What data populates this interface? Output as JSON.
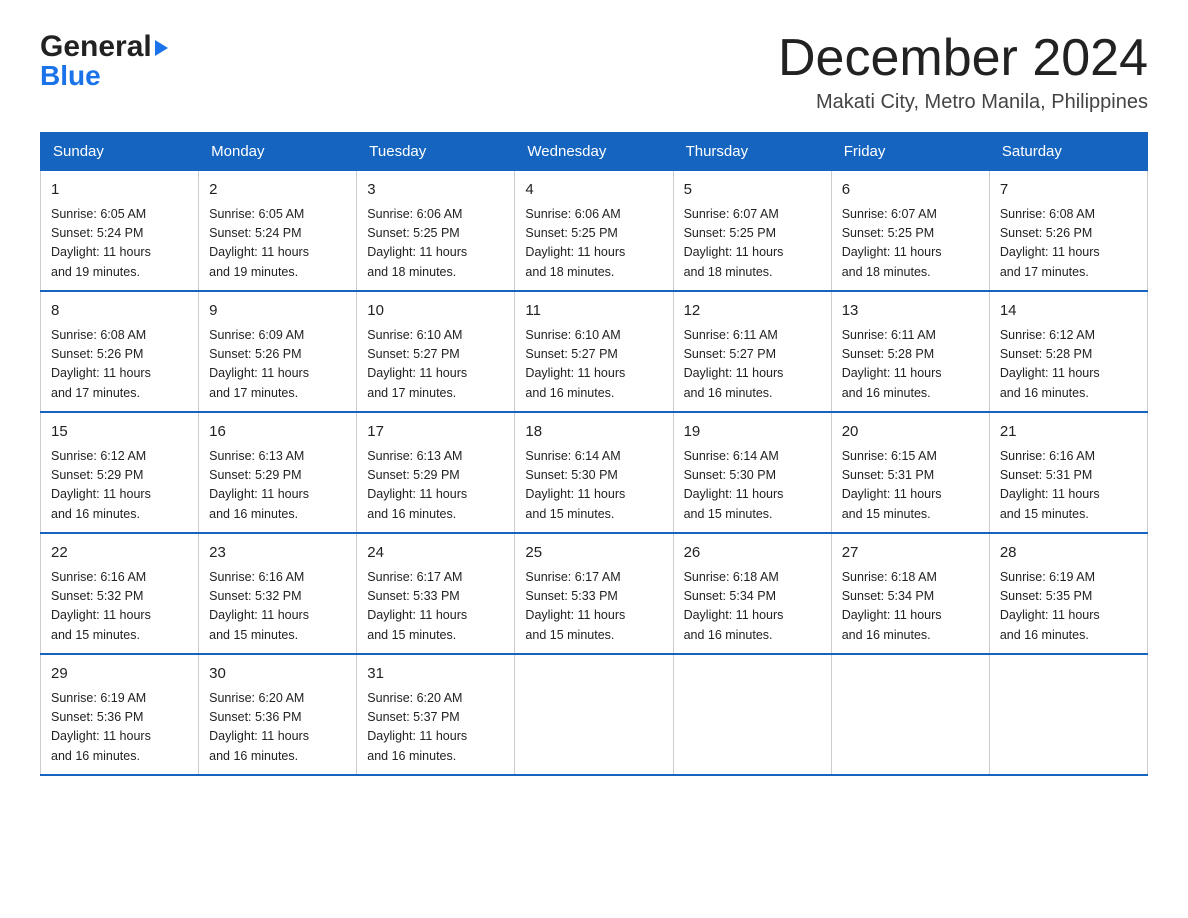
{
  "header": {
    "logo_general": "General",
    "logo_blue": "Blue",
    "month_title": "December 2024",
    "location": "Makati City, Metro Manila, Philippines"
  },
  "weekdays": [
    "Sunday",
    "Monday",
    "Tuesday",
    "Wednesday",
    "Thursday",
    "Friday",
    "Saturday"
  ],
  "weeks": [
    [
      {
        "day": "1",
        "sunrise": "6:05 AM",
        "sunset": "5:24 PM",
        "daylight": "11 hours and 19 minutes."
      },
      {
        "day": "2",
        "sunrise": "6:05 AM",
        "sunset": "5:24 PM",
        "daylight": "11 hours and 19 minutes."
      },
      {
        "day": "3",
        "sunrise": "6:06 AM",
        "sunset": "5:25 PM",
        "daylight": "11 hours and 18 minutes."
      },
      {
        "day": "4",
        "sunrise": "6:06 AM",
        "sunset": "5:25 PM",
        "daylight": "11 hours and 18 minutes."
      },
      {
        "day": "5",
        "sunrise": "6:07 AM",
        "sunset": "5:25 PM",
        "daylight": "11 hours and 18 minutes."
      },
      {
        "day": "6",
        "sunrise": "6:07 AM",
        "sunset": "5:25 PM",
        "daylight": "11 hours and 18 minutes."
      },
      {
        "day": "7",
        "sunrise": "6:08 AM",
        "sunset": "5:26 PM",
        "daylight": "11 hours and 17 minutes."
      }
    ],
    [
      {
        "day": "8",
        "sunrise": "6:08 AM",
        "sunset": "5:26 PM",
        "daylight": "11 hours and 17 minutes."
      },
      {
        "day": "9",
        "sunrise": "6:09 AM",
        "sunset": "5:26 PM",
        "daylight": "11 hours and 17 minutes."
      },
      {
        "day": "10",
        "sunrise": "6:10 AM",
        "sunset": "5:27 PM",
        "daylight": "11 hours and 17 minutes."
      },
      {
        "day": "11",
        "sunrise": "6:10 AM",
        "sunset": "5:27 PM",
        "daylight": "11 hours and 16 minutes."
      },
      {
        "day": "12",
        "sunrise": "6:11 AM",
        "sunset": "5:27 PM",
        "daylight": "11 hours and 16 minutes."
      },
      {
        "day": "13",
        "sunrise": "6:11 AM",
        "sunset": "5:28 PM",
        "daylight": "11 hours and 16 minutes."
      },
      {
        "day": "14",
        "sunrise": "6:12 AM",
        "sunset": "5:28 PM",
        "daylight": "11 hours and 16 minutes."
      }
    ],
    [
      {
        "day": "15",
        "sunrise": "6:12 AM",
        "sunset": "5:29 PM",
        "daylight": "11 hours and 16 minutes."
      },
      {
        "day": "16",
        "sunrise": "6:13 AM",
        "sunset": "5:29 PM",
        "daylight": "11 hours and 16 minutes."
      },
      {
        "day": "17",
        "sunrise": "6:13 AM",
        "sunset": "5:29 PM",
        "daylight": "11 hours and 16 minutes."
      },
      {
        "day": "18",
        "sunrise": "6:14 AM",
        "sunset": "5:30 PM",
        "daylight": "11 hours and 15 minutes."
      },
      {
        "day": "19",
        "sunrise": "6:14 AM",
        "sunset": "5:30 PM",
        "daylight": "11 hours and 15 minutes."
      },
      {
        "day": "20",
        "sunrise": "6:15 AM",
        "sunset": "5:31 PM",
        "daylight": "11 hours and 15 minutes."
      },
      {
        "day": "21",
        "sunrise": "6:16 AM",
        "sunset": "5:31 PM",
        "daylight": "11 hours and 15 minutes."
      }
    ],
    [
      {
        "day": "22",
        "sunrise": "6:16 AM",
        "sunset": "5:32 PM",
        "daylight": "11 hours and 15 minutes."
      },
      {
        "day": "23",
        "sunrise": "6:16 AM",
        "sunset": "5:32 PM",
        "daylight": "11 hours and 15 minutes."
      },
      {
        "day": "24",
        "sunrise": "6:17 AM",
        "sunset": "5:33 PM",
        "daylight": "11 hours and 15 minutes."
      },
      {
        "day": "25",
        "sunrise": "6:17 AM",
        "sunset": "5:33 PM",
        "daylight": "11 hours and 15 minutes."
      },
      {
        "day": "26",
        "sunrise": "6:18 AM",
        "sunset": "5:34 PM",
        "daylight": "11 hours and 16 minutes."
      },
      {
        "day": "27",
        "sunrise": "6:18 AM",
        "sunset": "5:34 PM",
        "daylight": "11 hours and 16 minutes."
      },
      {
        "day": "28",
        "sunrise": "6:19 AM",
        "sunset": "5:35 PM",
        "daylight": "11 hours and 16 minutes."
      }
    ],
    [
      {
        "day": "29",
        "sunrise": "6:19 AM",
        "sunset": "5:36 PM",
        "daylight": "11 hours and 16 minutes."
      },
      {
        "day": "30",
        "sunrise": "6:20 AM",
        "sunset": "5:36 PM",
        "daylight": "11 hours and 16 minutes."
      },
      {
        "day": "31",
        "sunrise": "6:20 AM",
        "sunset": "5:37 PM",
        "daylight": "11 hours and 16 minutes."
      },
      null,
      null,
      null,
      null
    ]
  ],
  "labels": {
    "sunrise": "Sunrise:",
    "sunset": "Sunset:",
    "daylight": "Daylight:"
  }
}
